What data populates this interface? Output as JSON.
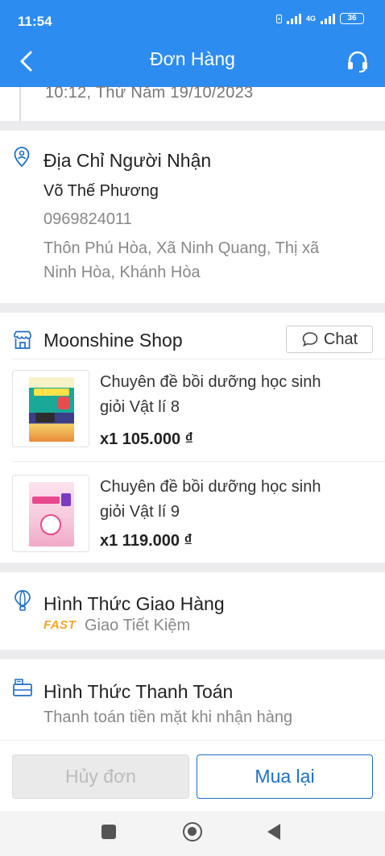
{
  "status": {
    "time": "11:54",
    "battery": "36",
    "net_label": "4G"
  },
  "header": {
    "title": "Đơn Hàng"
  },
  "timeline": {
    "time": "10:12, Thứ Năm 19/10/2023"
  },
  "address": {
    "title": "Địa Chỉ Người Nhận",
    "name": "Võ Thế Phương",
    "phone": "0969824011",
    "line1": "Thôn Phú Hòa, Xã Ninh Quang, Thị xã",
    "line2": "Ninh Hòa, Khánh Hòa"
  },
  "shop": {
    "name": "Moonshine Shop",
    "chat_label": "Chat",
    "products": [
      {
        "title_line1": "Chuyên đề bồi dưỡng học sinh",
        "title_line2": "giỏi Vật lí 8",
        "qty_price": "x1  105.000 ₫"
      },
      {
        "title_line1": "Chuyên đề bồi dưỡng học sinh",
        "title_line2": "giỏi Vật lí 9",
        "qty_price": "x1  119.000 ₫"
      }
    ]
  },
  "shipping": {
    "title": "Hình Thức Giao Hàng",
    "badge": "FAST",
    "method": "Giao Tiết Kiệm"
  },
  "payment": {
    "title": "Hình Thức Thanh Toán",
    "method": "Thanh toán tiền mặt khi nhận hàng"
  },
  "actions": {
    "cancel_label": "Hủy đơn",
    "rebuy_label": "Mua lại"
  },
  "colors": {
    "header": "#2d8cf0",
    "accent": "#1f6fc5",
    "fast": "#f5a623"
  }
}
